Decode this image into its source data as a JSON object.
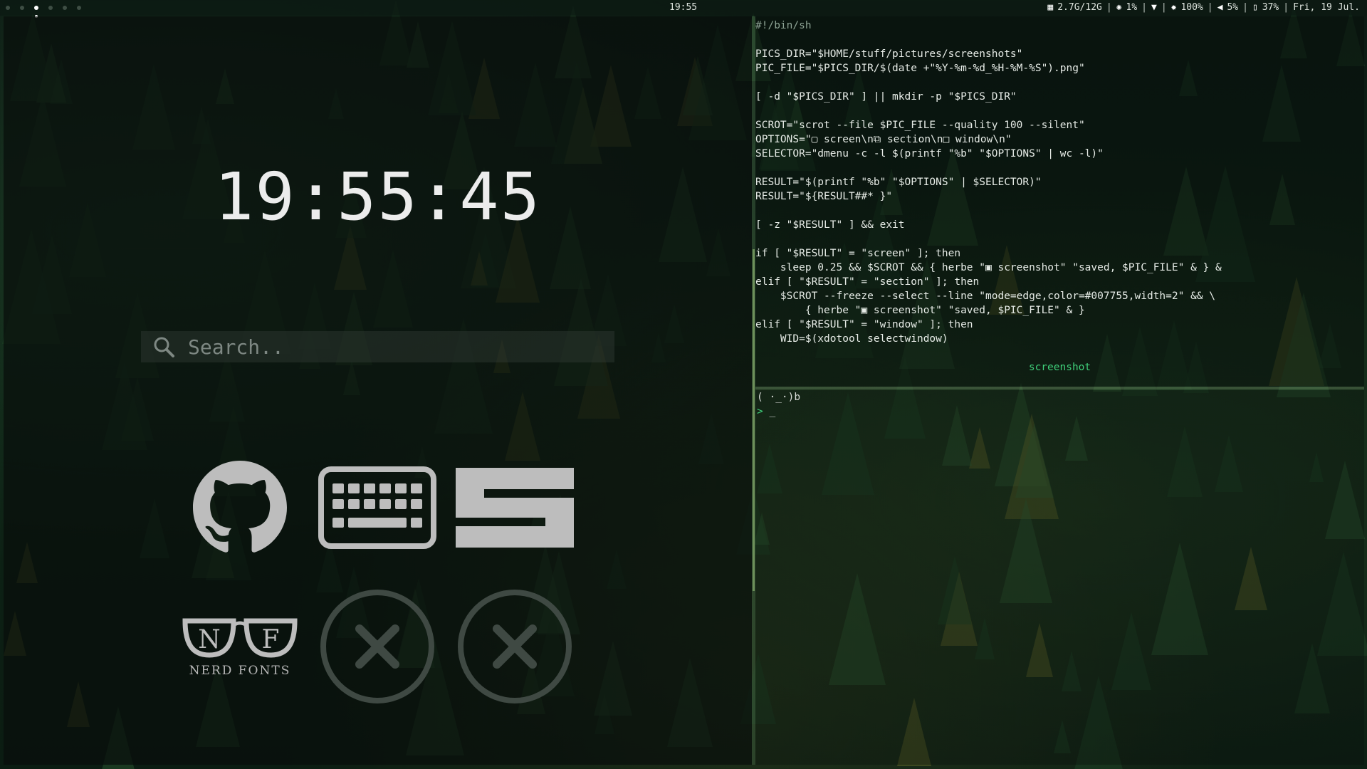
{
  "topbar": {
    "clock": "19:55",
    "status": {
      "memory": "2.7G/12G",
      "cpu": "1%",
      "brightness": "100%",
      "volume": "5%",
      "battery": "37%",
      "date": "Fri, 19 Jul."
    }
  },
  "launcher": {
    "clock": "19:55:45",
    "search": {
      "placeholder": "Search.."
    },
    "apps": [
      {
        "name": "github",
        "icon": "github-icon"
      },
      {
        "name": "keyboard",
        "icon": "keyboard-icon"
      },
      {
        "name": "s",
        "icon": "s-logo-icon"
      },
      {
        "name": "nerd fonts",
        "icon": "nerd-fonts-icon",
        "label": "NERD FONTS"
      },
      {
        "name": "empty-1",
        "icon": "close-circle-icon"
      },
      {
        "name": "empty-2",
        "icon": "close-circle-icon"
      }
    ]
  },
  "editor": {
    "lines": [
      "#!/bin/sh",
      "",
      "PICS_DIR=\"$HOME/stuff/pictures/screenshots\"",
      "PIC_FILE=\"$PICS_DIR/$(date +\"%Y-%m-%d_%H-%M-%S\").png\"",
      "",
      "[ -d \"$PICS_DIR\" ] || mkdir -p \"$PICS_DIR\"",
      "",
      "SCROT=\"scrot --file $PIC_FILE --quality 100 --silent\"",
      "OPTIONS=\"▢ screen\\n⧉ section\\n□ window\\n\"",
      "SELECTOR=\"dmenu -c -l $(printf \"%b\" \"$OPTIONS\" | wc -l)\"",
      "",
      "RESULT=\"$(printf \"%b\" \"$OPTIONS\" | $SELECTOR)\"",
      "RESULT=\"${RESULT##* }\"",
      "",
      "[ -z \"$RESULT\" ] && exit",
      "",
      "if [ \"$RESULT\" = \"screen\" ]; then",
      "    sleep 0.25 && $SCROT && { herbe \"▣ screenshot\" \"saved, $PIC_FILE\" & } &",
      "elif [ \"$RESULT\" = \"section\" ]; then",
      "    $SCROT --freeze --select --line \"mode=edge,color=#007755,width=2\" && \\",
      "        { herbe \"▣ screenshot\" \"saved, $PIC_FILE\" & }",
      "elif [ \"$RESULT\" = \"window\" ]; then",
      "    WID=$(xdotool selectwindow)"
    ],
    "modeline": "screenshot"
  },
  "shell": {
    "line1": "( ·_·)b",
    "prompt": ">",
    "cursor": "_"
  },
  "colors": {
    "accent": "#3fd07a",
    "text": "#e6ebe6",
    "icon": "#bdbdbd"
  }
}
